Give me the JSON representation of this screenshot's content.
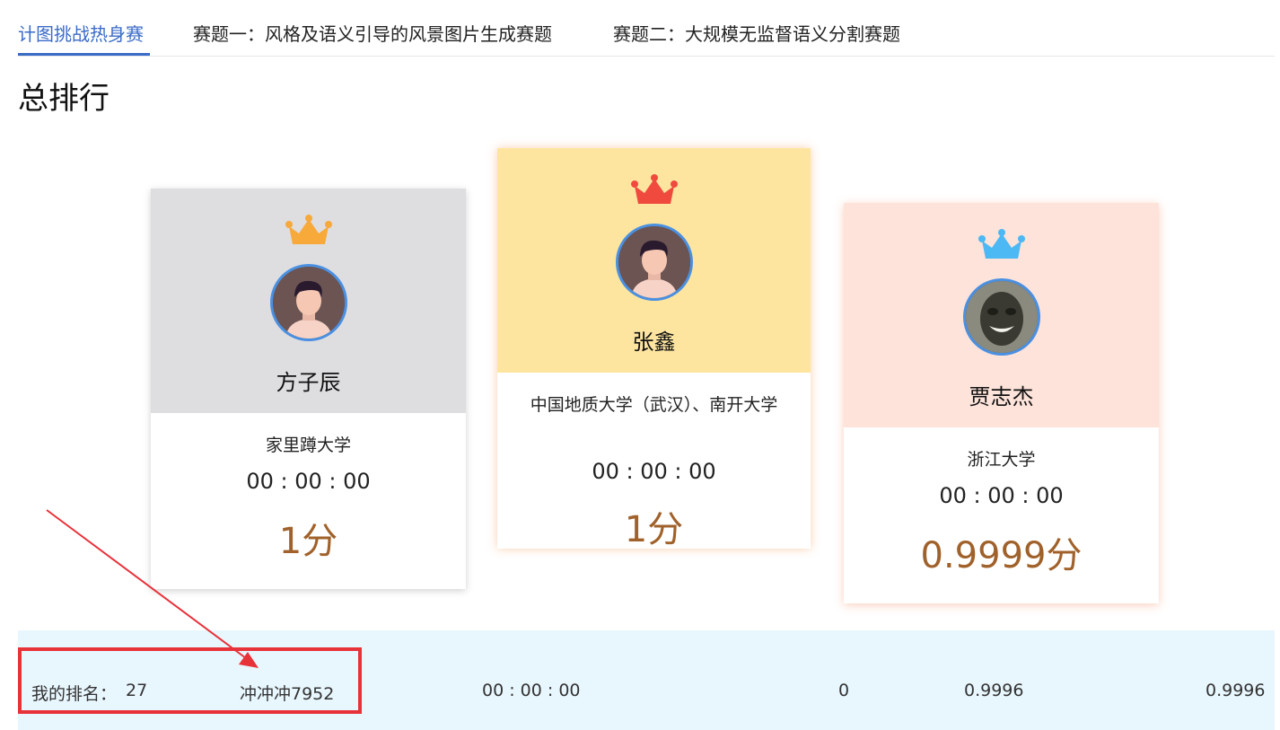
{
  "tabs": [
    {
      "label": "计图挑战热身赛"
    },
    {
      "label": "赛题一：风格及语义引导的风景图片生成赛题"
    },
    {
      "label": "赛题二：大规模无监督语义分割赛题"
    }
  ],
  "page_title": "总排行",
  "podium": [
    {
      "rank_position": "second",
      "name": "方子辰",
      "school": "家里蹲大学",
      "time": "00 : 00 : 00",
      "score": "1分",
      "crown_color": "#f7a93a",
      "top_bg": "#dedde0",
      "avatar_icon": "male-avatar-icon"
    },
    {
      "rank_position": "first",
      "name": "张鑫",
      "school": "中国地质大学（武汉）、南开大学",
      "time": "00 : 00 : 00",
      "score": "1分",
      "crown_color": "#f04a3e",
      "top_bg": "#fde5a0",
      "avatar_icon": "male-avatar-icon"
    },
    {
      "rank_position": "third",
      "name": "贾志杰",
      "school": "浙江大学",
      "time": "00 : 00 : 00",
      "score": "0.9999分",
      "crown_color": "#4cb8f4",
      "top_bg": "#fde3da",
      "avatar_icon": "photo-avatar-icon"
    }
  ],
  "my_rank": {
    "label": "我的排名：",
    "rank": "27",
    "name": "冲冲冲7952",
    "time": "00 : 00 : 00",
    "col_a": "0",
    "col_b": "0.9996",
    "col_c": "0.9996"
  },
  "colors": {
    "accent": "#3a6bc7",
    "score": "#a0612a",
    "annotation": "#e8323a",
    "my_row_bg": "#e8f6fd"
  }
}
